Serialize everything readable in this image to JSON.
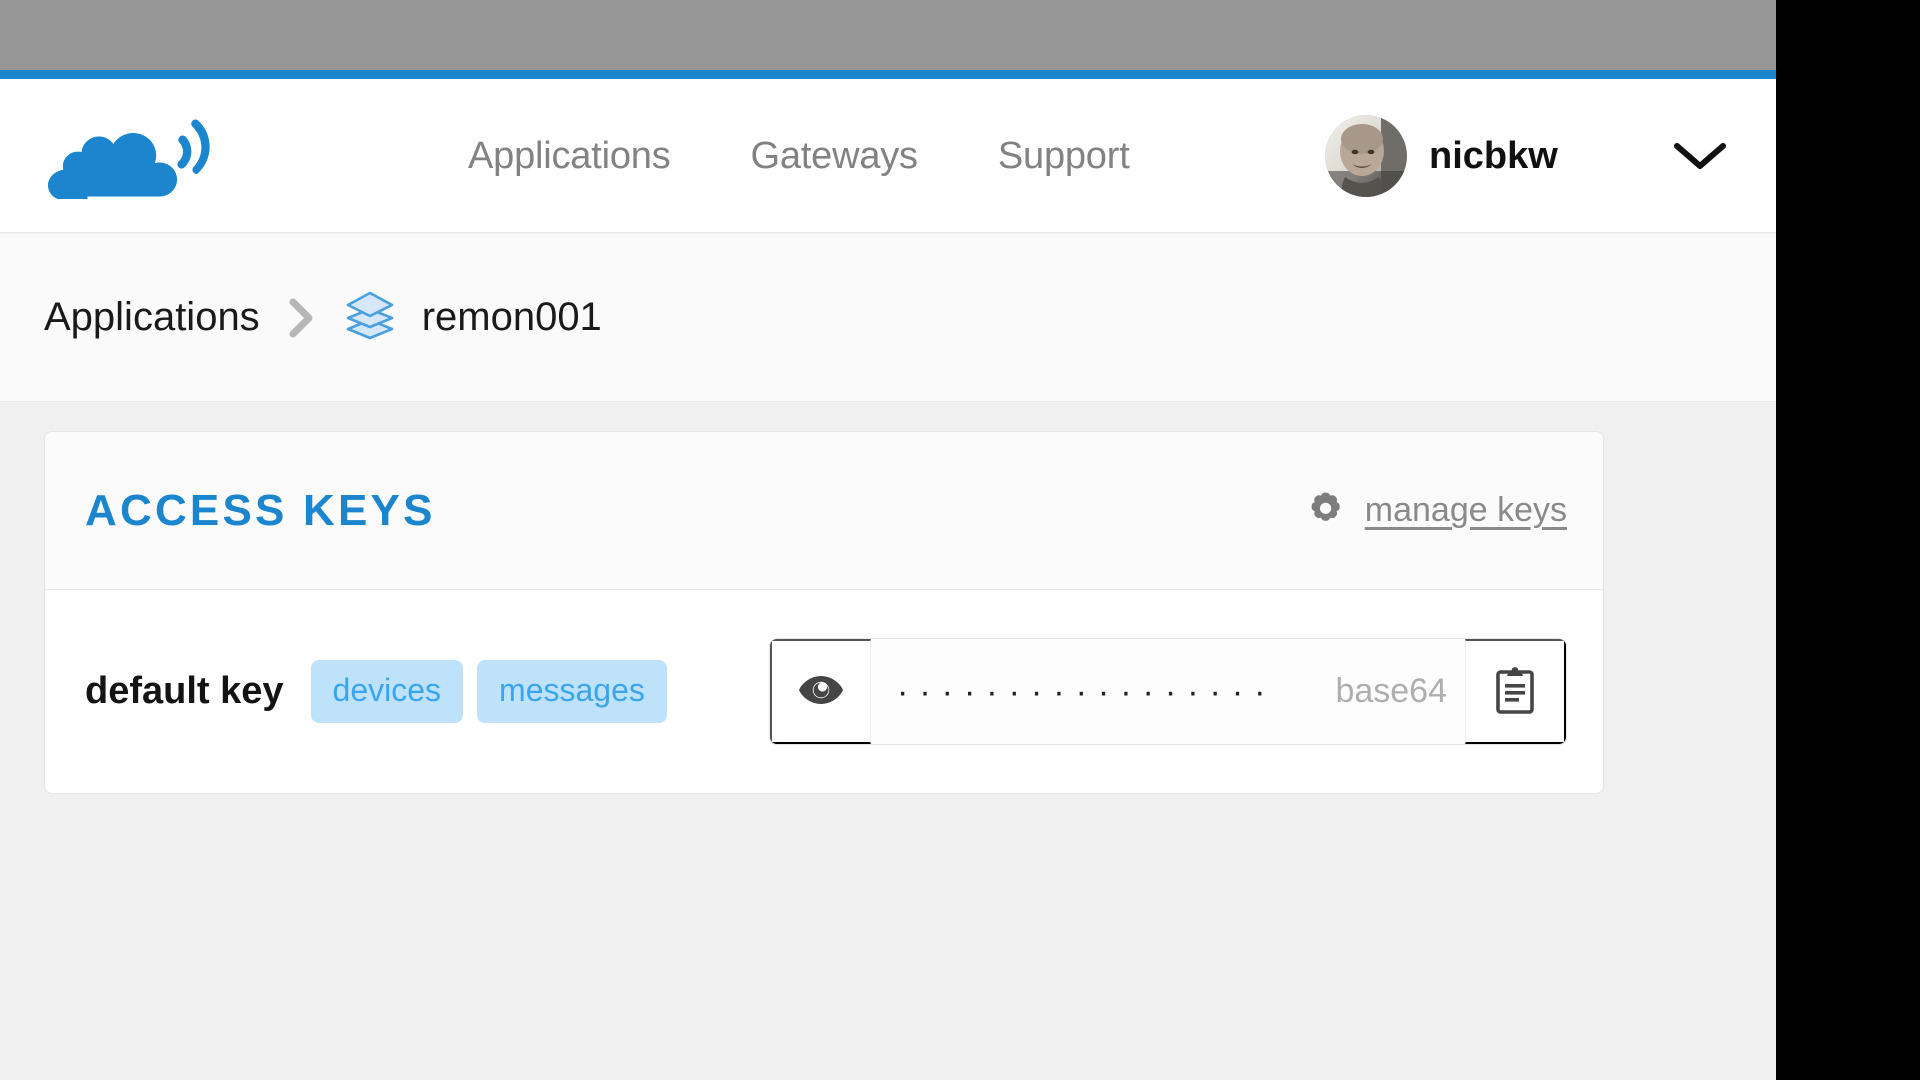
{
  "theme": {
    "brand_blue": "#1b86cd",
    "badge_bg": "#bfe2fb",
    "badge_text": "#3aa5ef",
    "page_bg": "#f0f0f0",
    "chrome_gray": "#969696"
  },
  "header": {
    "logo_name": "cloud-signal-logo",
    "nav": [
      {
        "label": "Applications",
        "name": "nav-applications"
      },
      {
        "label": "Gateways",
        "name": "nav-gateways"
      },
      {
        "label": "Support",
        "name": "nav-support"
      }
    ],
    "user": {
      "username": "nicbkw",
      "avatar_alt": "user-avatar",
      "menu_icon": "chevron-down-icon"
    }
  },
  "breadcrumb": {
    "root_label": "Applications",
    "separator": "chevron-right-icon",
    "app_icon": "layers-icon",
    "current_label": "remon001"
  },
  "main": {
    "card": {
      "title": "ACCESS KEYS",
      "manage_link": {
        "label": "manage keys",
        "icon": "gear-icon"
      },
      "key_row": {
        "name": "default key",
        "badges": [
          "devices",
          "messages"
        ],
        "field": {
          "reveal_icon": "eye-icon",
          "copy_icon": "clipboard-icon",
          "masked_value": "·················",
          "encoding": "base64"
        }
      }
    }
  }
}
